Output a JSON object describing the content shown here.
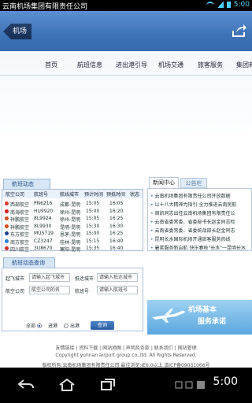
{
  "status_bar": {
    "title": "云南机场集团有限责任公司",
    "time": "5:00"
  },
  "app_bar": {
    "back_label": "机场",
    "share_icon": "share-icon"
  },
  "nav": {
    "items": [
      "首页",
      "航班信息",
      "进出港引导",
      "机场交通",
      "旅客服务",
      "集团新"
    ]
  },
  "flight_panel": {
    "tab_label": "航班动态",
    "columns": [
      "航空公司",
      "航班号",
      "航线城市",
      "预计时间",
      "预抵时间",
      "状态"
    ],
    "rows": [
      {
        "airline": "西部航空",
        "flight": "PN6216",
        "route": "成都-昆明",
        "dep": "15:05",
        "arr": "16:05",
        "status": "",
        "color": "#e23a2a"
      },
      {
        "airline": "南海航空",
        "flight": "HU9920",
        "route": "徐州-昆明",
        "dep": "15:00",
        "arr": "16:20",
        "status": "",
        "color": "#d81e1e"
      },
      {
        "airline": "祥鹏航空",
        "flight": "8L9924",
        "route": "徐州-昆明",
        "dep": "15:05",
        "arr": "16:25",
        "status": "",
        "color": "#d94a1a"
      },
      {
        "airline": "祥鹏航空",
        "flight": "8L9930",
        "route": "昆明-昆明",
        "dep": "15:30",
        "arr": "16:30",
        "status": "",
        "color": "#d94a1a"
      },
      {
        "airline": "东方航空",
        "flight": "MU5719",
        "route": "恩茅-昆明",
        "dep": "15:00",
        "arr": "16:25",
        "status": "",
        "color": "#1c3f8e"
      },
      {
        "airline": "南方航空",
        "flight": "CZ3247",
        "route": "桂林-昆明",
        "dep": "15:15",
        "arr": "16:40",
        "status": "",
        "color": "#2a7fd0"
      },
      {
        "airline": "四川航空",
        "flight": "3U8670",
        "route": "寒阳-昆明",
        "dep": "15:35",
        "arr": "16:40",
        "status": "",
        "color": "#cc2a2a"
      }
    ]
  },
  "news_panel": {
    "tab_active": "新闻中心",
    "tab_other": "公告栏",
    "items": [
      "云南机场集团有限责任公司开放数据",
      "以十八大精神为指引 全力推进云南民航",
      "周凯同志出任云南机场集团有限责任公",
      "云南省委常委、省委秘书长赵金同志检",
      "云南省委常委、省委统战部长赵金同志",
      "昆明长水国际机场开通旅客服务热线",
      "暑笑服务新启航 快乐春秋\"长水\"一昆明长水"
    ]
  },
  "search_panel": {
    "tab_label": "航班动态查询",
    "dep_label": "起飞城市",
    "dep_placeholder": "请输入起飞城市",
    "arr_label": "抵达城市",
    "arr_placeholder": "请输入抵达城市",
    "airline_label": "航空公司",
    "airline_placeholder": "航空公司的名",
    "flight_label": "航班号",
    "flight_placeholder": "请输入航班号",
    "scope_label": "全部",
    "inbound_label": "进港",
    "outbound_label": "出港",
    "search_button": "查询"
  },
  "banner": {
    "line1": "机场基本",
    "line2": "服务承诺"
  },
  "footer": {
    "links": "友情链接 | 资料下载 | 网站地图 | 声明及条款 | 联系我们 | 网站管理",
    "copyright": "Copyright yunnan airport group co.,ltd. All Rights Reserved.",
    "icp": "版权所有:云南机场集团有限责任公司 最佳浏览:IE6.0以上 滇ICP备09031066号"
  },
  "colors": {
    "appbar": "#3e73b8",
    "accent": "#2a5da6",
    "status_icons": "#4fd2ff"
  }
}
